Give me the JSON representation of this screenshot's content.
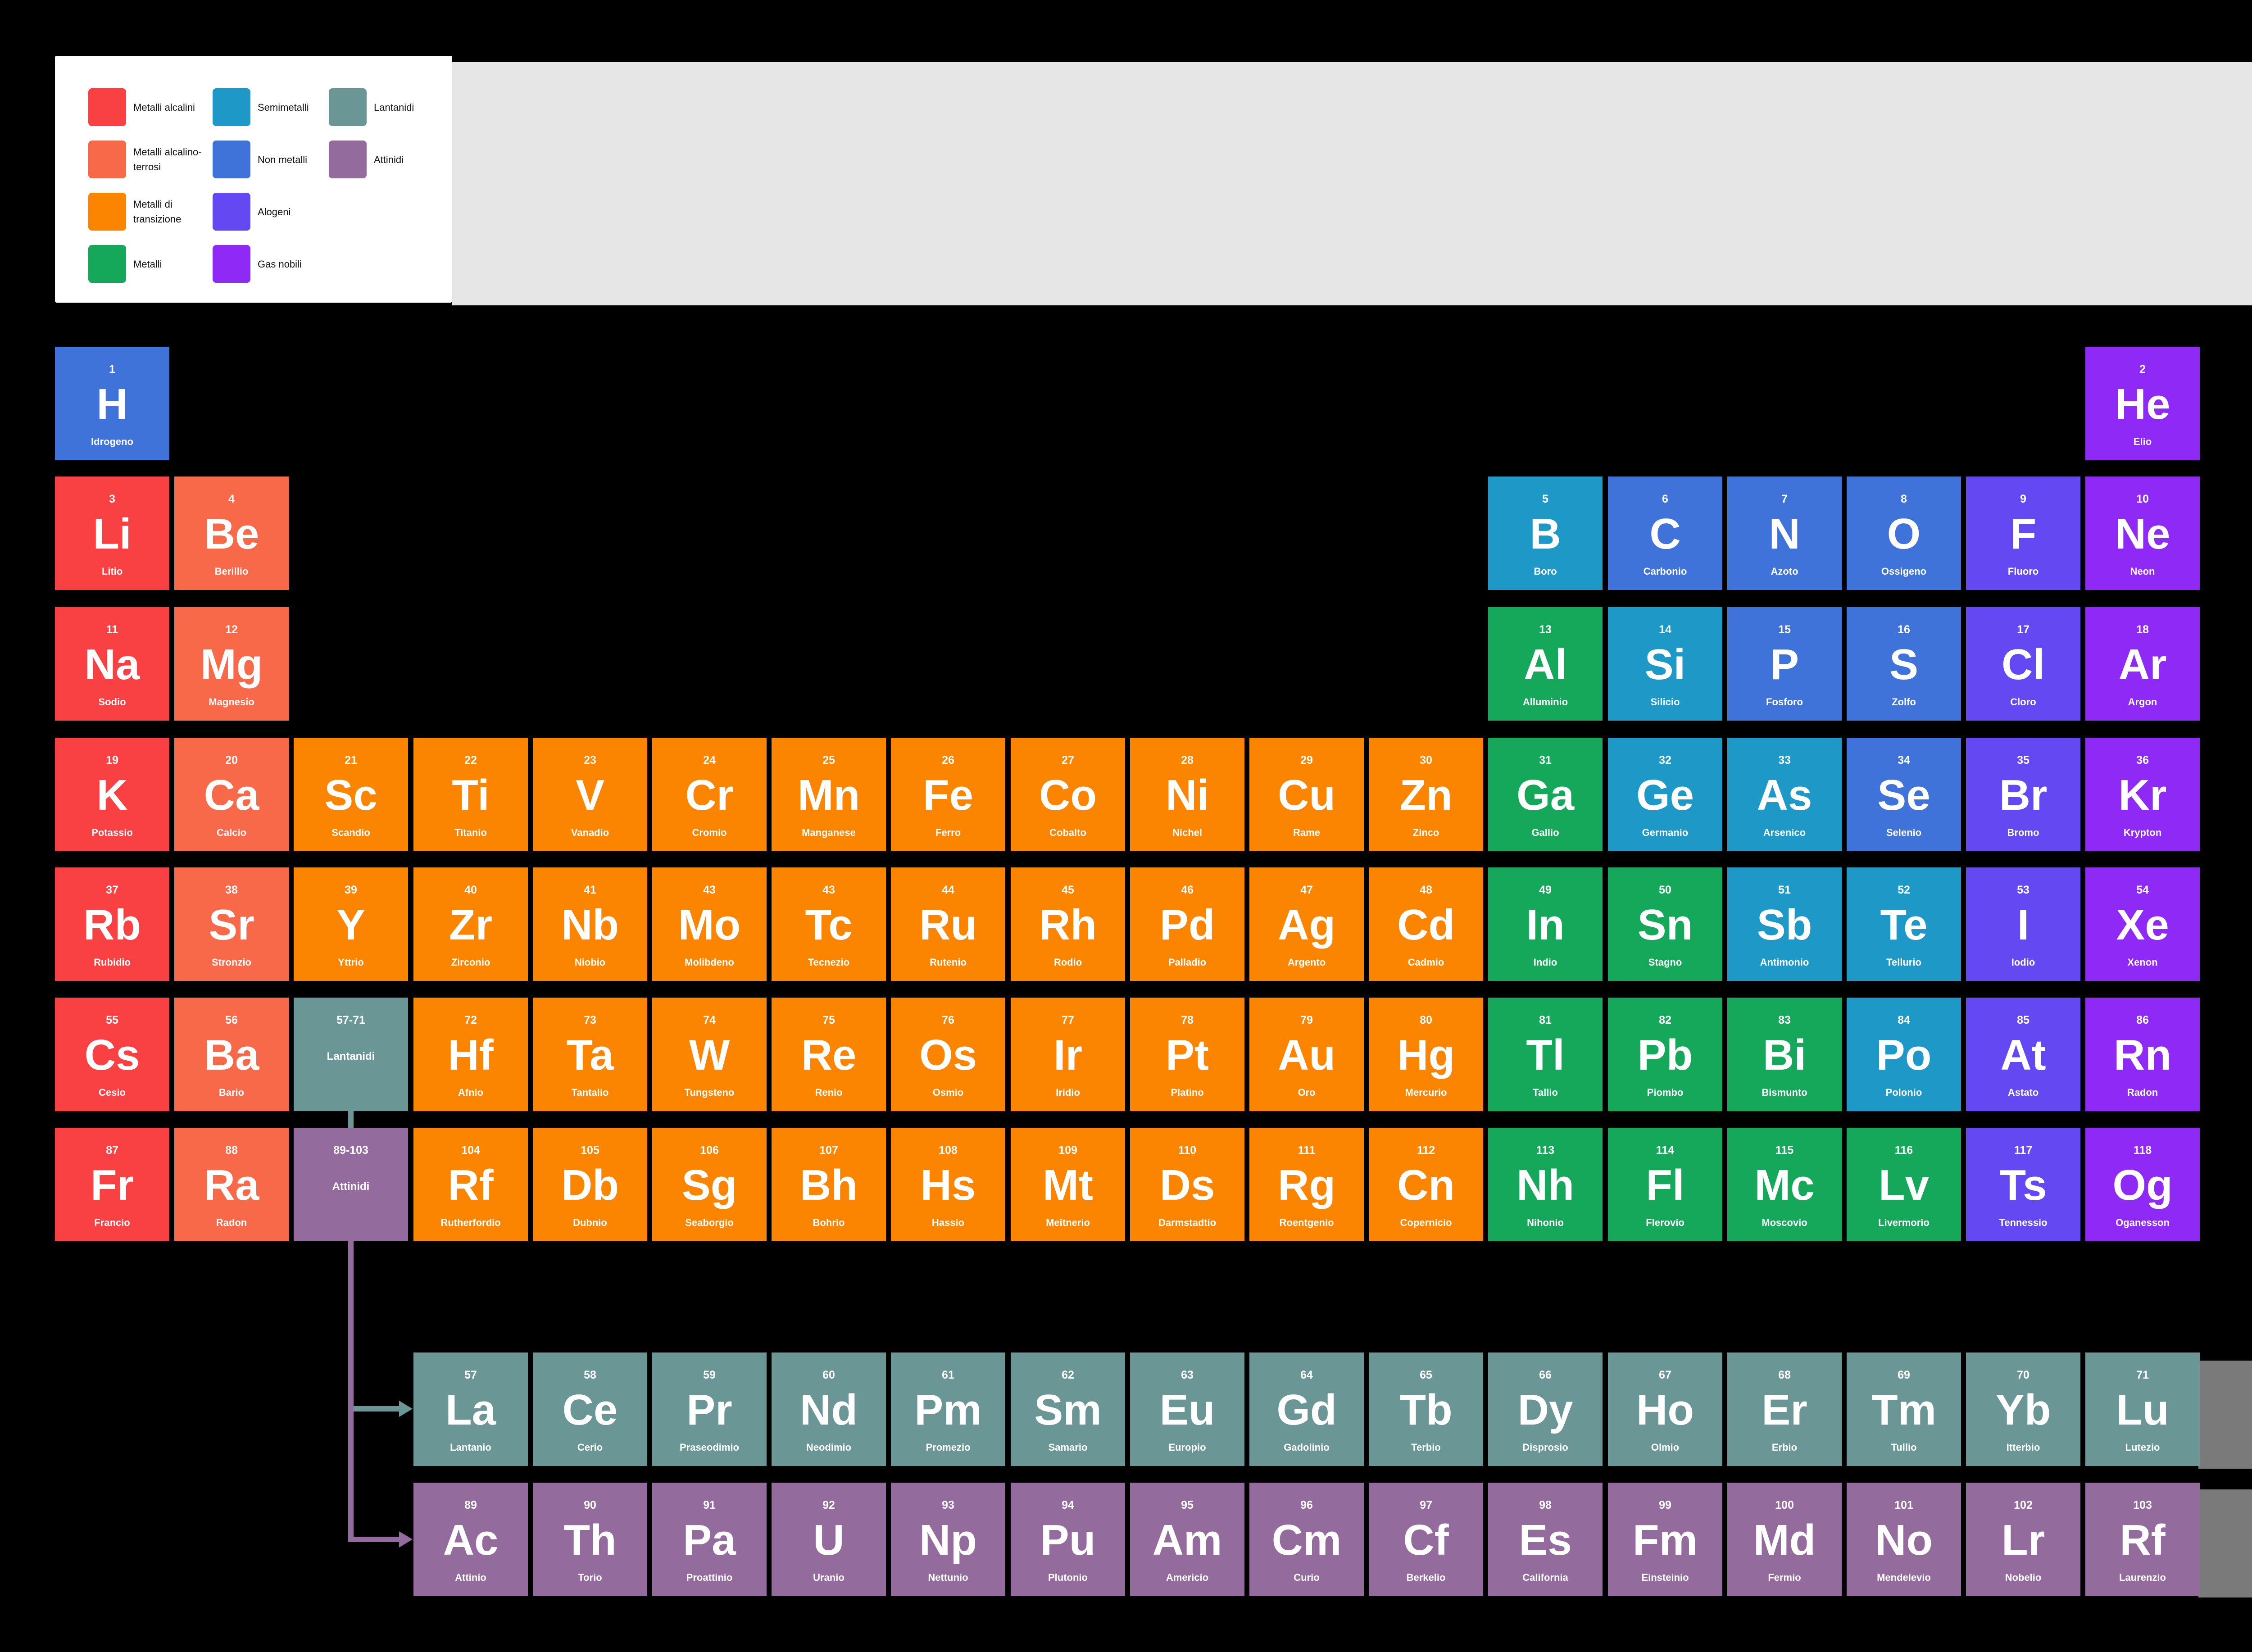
{
  "colors": {
    "alkali": "#f94144",
    "alkaline": "#f8694a",
    "transition": "#fb8500",
    "metal": "#16a85a",
    "metalloid": "#1d98c7",
    "nonmetal": "#3f73d9",
    "halogen": "#6448f2",
    "noble": "#8f2af6",
    "lanthanide": "#6a9695",
    "actinide": "#936b9c"
  },
  "legend": [
    {
      "label": "Metalli alcalini",
      "cat": "alkali"
    },
    {
      "label": "Metalli alcalino-terrosi",
      "cat": "alkaline"
    },
    {
      "label": "Metalli di transizione",
      "cat": "transition"
    },
    {
      "label": "Metalli",
      "cat": "metal"
    },
    {
      "label": "Semimetalli",
      "cat": "metalloid"
    },
    {
      "label": "Non metalli",
      "cat": "nonmetal"
    },
    {
      "label": "Alogeni",
      "cat": "halogen"
    },
    {
      "label": "Gas nobili",
      "cat": "noble"
    },
    {
      "label": "Lantanidi",
      "cat": "lanthanide"
    },
    {
      "label": "Attinidi",
      "cat": "actinide"
    }
  ],
  "elements": [
    {
      "n": "1",
      "s": "H",
      "name": "Idrogeno",
      "c": "nonmetal",
      "r": 0,
      "g": 0
    },
    {
      "n": "2",
      "s": "He",
      "name": "Elio",
      "c": "noble",
      "r": 0,
      "g": 17
    },
    {
      "n": "3",
      "s": "Li",
      "name": "Litio",
      "c": "alkali",
      "r": 1,
      "g": 0
    },
    {
      "n": "4",
      "s": "Be",
      "name": "Berillio",
      "c": "alkaline",
      "r": 1,
      "g": 1
    },
    {
      "n": "5",
      "s": "B",
      "name": "Boro",
      "c": "metalloid",
      "r": 1,
      "g": 12
    },
    {
      "n": "6",
      "s": "C",
      "name": "Carbonio",
      "c": "nonmetal",
      "r": 1,
      "g": 13
    },
    {
      "n": "7",
      "s": "N",
      "name": "Azoto",
      "c": "nonmetal",
      "r": 1,
      "g": 14
    },
    {
      "n": "8",
      "s": "O",
      "name": "Ossigeno",
      "c": "nonmetal",
      "r": 1,
      "g": 15
    },
    {
      "n": "9",
      "s": "F",
      "name": "Fluoro",
      "c": "halogen",
      "r": 1,
      "g": 16
    },
    {
      "n": "10",
      "s": "Ne",
      "name": "Neon",
      "c": "noble",
      "r": 1,
      "g": 17
    },
    {
      "n": "11",
      "s": "Na",
      "name": "Sodio",
      "c": "alkali",
      "r": 2,
      "g": 0
    },
    {
      "n": "12",
      "s": "Mg",
      "name": "Magnesio",
      "c": "alkaline",
      "r": 2,
      "g": 1
    },
    {
      "n": "13",
      "s": "Al",
      "name": "Alluminio",
      "c": "metal",
      "r": 2,
      "g": 12
    },
    {
      "n": "14",
      "s": "Si",
      "name": "Silicio",
      "c": "metalloid",
      "r": 2,
      "g": 13
    },
    {
      "n": "15",
      "s": "P",
      "name": "Fosforo",
      "c": "nonmetal",
      "r": 2,
      "g": 14
    },
    {
      "n": "16",
      "s": "S",
      "name": "Zolfo",
      "c": "nonmetal",
      "r": 2,
      "g": 15
    },
    {
      "n": "17",
      "s": "Cl",
      "name": "Cloro",
      "c": "halogen",
      "r": 2,
      "g": 16
    },
    {
      "n": "18",
      "s": "Ar",
      "name": "Argon",
      "c": "noble",
      "r": 2,
      "g": 17
    },
    {
      "n": "19",
      "s": "K",
      "name": "Potassio",
      "c": "alkali",
      "r": 3,
      "g": 0
    },
    {
      "n": "20",
      "s": "Ca",
      "name": "Calcio",
      "c": "alkaline",
      "r": 3,
      "g": 1
    },
    {
      "n": "21",
      "s": "Sc",
      "name": "Scandio",
      "c": "transition",
      "r": 3,
      "g": 2
    },
    {
      "n": "22",
      "s": "Ti",
      "name": "Titanio",
      "c": "transition",
      "r": 3,
      "g": 3
    },
    {
      "n": "23",
      "s": "V",
      "name": "Vanadio",
      "c": "transition",
      "r": 3,
      "g": 4
    },
    {
      "n": "24",
      "s": "Cr",
      "name": "Cromio",
      "c": "transition",
      "r": 3,
      "g": 5
    },
    {
      "n": "25",
      "s": "Mn",
      "name": "Manganese",
      "c": "transition",
      "r": 3,
      "g": 6
    },
    {
      "n": "26",
      "s": "Fe",
      "name": "Ferro",
      "c": "transition",
      "r": 3,
      "g": 7
    },
    {
      "n": "27",
      "s": "Co",
      "name": "Cobalto",
      "c": "transition",
      "r": 3,
      "g": 8
    },
    {
      "n": "28",
      "s": "Ni",
      "name": "Nichel",
      "c": "transition",
      "r": 3,
      "g": 9
    },
    {
      "n": "29",
      "s": "Cu",
      "name": "Rame",
      "c": "transition",
      "r": 3,
      "g": 10
    },
    {
      "n": "30",
      "s": "Zn",
      "name": "Zinco",
      "c": "transition",
      "r": 3,
      "g": 11
    },
    {
      "n": "31",
      "s": "Ga",
      "name": "Gallio",
      "c": "metal",
      "r": 3,
      "g": 12
    },
    {
      "n": "32",
      "s": "Ge",
      "name": "Germanio",
      "c": "metalloid",
      "r": 3,
      "g": 13
    },
    {
      "n": "33",
      "s": "As",
      "name": "Arsenico",
      "c": "metalloid",
      "r": 3,
      "g": 14
    },
    {
      "n": "34",
      "s": "Se",
      "name": "Selenio",
      "c": "nonmetal",
      "r": 3,
      "g": 15
    },
    {
      "n": "35",
      "s": "Br",
      "name": "Bromo",
      "c": "halogen",
      "r": 3,
      "g": 16
    },
    {
      "n": "36",
      "s": "Kr",
      "name": "Krypton",
      "c": "noble",
      "r": 3,
      "g": 17
    },
    {
      "n": "37",
      "s": "Rb",
      "name": "Rubidio",
      "c": "alkali",
      "r": 4,
      "g": 0
    },
    {
      "n": "38",
      "s": "Sr",
      "name": "Stronzio",
      "c": "alkaline",
      "r": 4,
      "g": 1
    },
    {
      "n": "39",
      "s": "Y",
      "name": "Yttrio",
      "c": "transition",
      "r": 4,
      "g": 2
    },
    {
      "n": "40",
      "s": "Zr",
      "name": "Zirconio",
      "c": "transition",
      "r": 4,
      "g": 3
    },
    {
      "n": "41",
      "s": "Nb",
      "name": "Niobio",
      "c": "transition",
      "r": 4,
      "g": 4
    },
    {
      "n": "43",
      "s": "Mo",
      "name": "Molibdeno",
      "c": "transition",
      "r": 4,
      "g": 5
    },
    {
      "n": "43",
      "s": "Tc",
      "name": "Tecnezio",
      "c": "transition",
      "r": 4,
      "g": 6
    },
    {
      "n": "44",
      "s": "Ru",
      "name": "Rutenio",
      "c": "transition",
      "r": 4,
      "g": 7
    },
    {
      "n": "45",
      "s": "Rh",
      "name": "Rodio",
      "c": "transition",
      "r": 4,
      "g": 8
    },
    {
      "n": "46",
      "s": "Pd",
      "name": "Palladio",
      "c": "transition",
      "r": 4,
      "g": 9
    },
    {
      "n": "47",
      "s": "Ag",
      "name": "Argento",
      "c": "transition",
      "r": 4,
      "g": 10
    },
    {
      "n": "48",
      "s": "Cd",
      "name": "Cadmio",
      "c": "transition",
      "r": 4,
      "g": 11
    },
    {
      "n": "49",
      "s": "In",
      "name": "Indio",
      "c": "metal",
      "r": 4,
      "g": 12
    },
    {
      "n": "50",
      "s": "Sn",
      "name": "Stagno",
      "c": "metal",
      "r": 4,
      "g": 13
    },
    {
      "n": "51",
      "s": "Sb",
      "name": "Antimonio",
      "c": "metalloid",
      "r": 4,
      "g": 14
    },
    {
      "n": "52",
      "s": "Te",
      "name": "Tellurio",
      "c": "metalloid",
      "r": 4,
      "g": 15
    },
    {
      "n": "53",
      "s": "I",
      "name": "Iodio",
      "c": "halogen",
      "r": 4,
      "g": 16
    },
    {
      "n": "54",
      "s": "Xe",
      "name": "Xenon",
      "c": "noble",
      "r": 4,
      "g": 17
    },
    {
      "n": "55",
      "s": "Cs",
      "name": "Cesio",
      "c": "alkali",
      "r": 5,
      "g": 0
    },
    {
      "n": "56",
      "s": "Ba",
      "name": "Bario",
      "c": "alkaline",
      "r": 5,
      "g": 1
    },
    {
      "n": "57-71",
      "s": "",
      "name": "Lantanidi",
      "c": "lanthanide",
      "r": 5,
      "g": 2,
      "series": true
    },
    {
      "n": "72",
      "s": "Hf",
      "name": "Afnio",
      "c": "transition",
      "r": 5,
      "g": 3
    },
    {
      "n": "73",
      "s": "Ta",
      "name": "Tantalio",
      "c": "transition",
      "r": 5,
      "g": 4
    },
    {
      "n": "74",
      "s": "W",
      "name": "Tungsteno",
      "c": "transition",
      "r": 5,
      "g": 5
    },
    {
      "n": "75",
      "s": "Re",
      "name": "Renio",
      "c": "transition",
      "r": 5,
      "g": 6
    },
    {
      "n": "76",
      "s": "Os",
      "name": "Osmio",
      "c": "transition",
      "r": 5,
      "g": 7
    },
    {
      "n": "77",
      "s": "Ir",
      "name": "Iridio",
      "c": "transition",
      "r": 5,
      "g": 8
    },
    {
      "n": "78",
      "s": "Pt",
      "name": "Platino",
      "c": "transition",
      "r": 5,
      "g": 9
    },
    {
      "n": "79",
      "s": "Au",
      "name": "Oro",
      "c": "transition",
      "r": 5,
      "g": 10
    },
    {
      "n": "80",
      "s": "Hg",
      "name": "Mercurio",
      "c": "transition",
      "r": 5,
      "g": 11
    },
    {
      "n": "81",
      "s": "Tl",
      "name": "Tallio",
      "c": "metal",
      "r": 5,
      "g": 12
    },
    {
      "n": "82",
      "s": "Pb",
      "name": "Piombo",
      "c": "metal",
      "r": 5,
      "g": 13
    },
    {
      "n": "83",
      "s": "Bi",
      "name": "Bismunto",
      "c": "metal",
      "r": 5,
      "g": 14
    },
    {
      "n": "84",
      "s": "Po",
      "name": "Polonio",
      "c": "metalloid",
      "r": 5,
      "g": 15
    },
    {
      "n": "85",
      "s": "At",
      "name": "Astato",
      "c": "halogen",
      "r": 5,
      "g": 16
    },
    {
      "n": "86",
      "s": "Rn",
      "name": "Radon",
      "c": "noble",
      "r": 5,
      "g": 17
    },
    {
      "n": "87",
      "s": "Fr",
      "name": "Francio",
      "c": "alkali",
      "r": 6,
      "g": 0
    },
    {
      "n": "88",
      "s": "Ra",
      "name": "Radon",
      "c": "alkaline",
      "r": 6,
      "g": 1
    },
    {
      "n": "89-103",
      "s": "",
      "name": "Attinidi",
      "c": "actinide",
      "r": 6,
      "g": 2,
      "series": true
    },
    {
      "n": "104",
      "s": "Rf",
      "name": "Rutherfordio",
      "c": "transition",
      "r": 6,
      "g": 3
    },
    {
      "n": "105",
      "s": "Db",
      "name": "Dubnio",
      "c": "transition",
      "r": 6,
      "g": 4
    },
    {
      "n": "106",
      "s": "Sg",
      "name": "Seaborgio",
      "c": "transition",
      "r": 6,
      "g": 5
    },
    {
      "n": "107",
      "s": "Bh",
      "name": "Bohrio",
      "c": "transition",
      "r": 6,
      "g": 6
    },
    {
      "n": "108",
      "s": "Hs",
      "name": "Hassio",
      "c": "transition",
      "r": 6,
      "g": 7
    },
    {
      "n": "109",
      "s": "Mt",
      "name": "Meitnerio",
      "c": "transition",
      "r": 6,
      "g": 8
    },
    {
      "n": "110",
      "s": "Ds",
      "name": "Darmstadtio",
      "c": "transition",
      "r": 6,
      "g": 9
    },
    {
      "n": "111",
      "s": "Rg",
      "name": "Roentgenio",
      "c": "transition",
      "r": 6,
      "g": 10
    },
    {
      "n": "112",
      "s": "Cn",
      "name": "Copernicio",
      "c": "transition",
      "r": 6,
      "g": 11
    },
    {
      "n": "113",
      "s": "Nh",
      "name": "Nihonio",
      "c": "metal",
      "r": 6,
      "g": 12
    },
    {
      "n": "114",
      "s": "Fl",
      "name": "Flerovio",
      "c": "metal",
      "r": 6,
      "g": 13
    },
    {
      "n": "115",
      "s": "Mc",
      "name": "Moscovio",
      "c": "metal",
      "r": 6,
      "g": 14
    },
    {
      "n": "116",
      "s": "Lv",
      "name": "Livermorio",
      "c": "metal",
      "r": 6,
      "g": 15
    },
    {
      "n": "117",
      "s": "Ts",
      "name": "Tennessio",
      "c": "halogen",
      "r": 6,
      "g": 16
    },
    {
      "n": "118",
      "s": "Og",
      "name": "Oganesson",
      "c": "noble",
      "r": 6,
      "g": 17
    },
    {
      "n": "57",
      "s": "La",
      "name": "Lantanio",
      "c": "lanthanide",
      "r": 7,
      "g": 3
    },
    {
      "n": "58",
      "s": "Ce",
      "name": "Cerio",
      "c": "lanthanide",
      "r": 7,
      "g": 4
    },
    {
      "n": "59",
      "s": "Pr",
      "name": "Praseodimio",
      "c": "lanthanide",
      "r": 7,
      "g": 5
    },
    {
      "n": "60",
      "s": "Nd",
      "name": "Neodimio",
      "c": "lanthanide",
      "r": 7,
      "g": 6
    },
    {
      "n": "61",
      "s": "Pm",
      "name": "Promezio",
      "c": "lanthanide",
      "r": 7,
      "g": 7
    },
    {
      "n": "62",
      "s": "Sm",
      "name": "Samario",
      "c": "lanthanide",
      "r": 7,
      "g": 8
    },
    {
      "n": "63",
      "s": "Eu",
      "name": "Europio",
      "c": "lanthanide",
      "r": 7,
      "g": 9
    },
    {
      "n": "64",
      "s": "Gd",
      "name": "Gadolinio",
      "c": "lanthanide",
      "r": 7,
      "g": 10
    },
    {
      "n": "65",
      "s": "Tb",
      "name": "Terbio",
      "c": "lanthanide",
      "r": 7,
      "g": 11
    },
    {
      "n": "66",
      "s": "Dy",
      "name": "Disprosio",
      "c": "lanthanide",
      "r": 7,
      "g": 12
    },
    {
      "n": "67",
      "s": "Ho",
      "name": "Olmio",
      "c": "lanthanide",
      "r": 7,
      "g": 13
    },
    {
      "n": "68",
      "s": "Er",
      "name": "Erbio",
      "c": "lanthanide",
      "r": 7,
      "g": 14
    },
    {
      "n": "69",
      "s": "Tm",
      "name": "Tullio",
      "c": "lanthanide",
      "r": 7,
      "g": 15
    },
    {
      "n": "70",
      "s": "Yb",
      "name": "Itterbio",
      "c": "lanthanide",
      "r": 7,
      "g": 16
    },
    {
      "n": "71",
      "s": "Lu",
      "name": "Lutezio",
      "c": "lanthanide",
      "r": 7,
      "g": 17
    },
    {
      "n": "89",
      "s": "Ac",
      "name": "Attinio",
      "c": "actinide",
      "r": 8,
      "g": 3
    },
    {
      "n": "90",
      "s": "Th",
      "name": "Torio",
      "c": "actinide",
      "r": 8,
      "g": 4
    },
    {
      "n": "91",
      "s": "Pa",
      "name": "Proattinio",
      "c": "actinide",
      "r": 8,
      "g": 5
    },
    {
      "n": "92",
      "s": "U",
      "name": "Uranio",
      "c": "actinide",
      "r": 8,
      "g": 6
    },
    {
      "n": "93",
      "s": "Np",
      "name": "Nettunio",
      "c": "actinide",
      "r": 8,
      "g": 7
    },
    {
      "n": "94",
      "s": "Pu",
      "name": "Plutonio",
      "c": "actinide",
      "r": 8,
      "g": 8
    },
    {
      "n": "95",
      "s": "Am",
      "name": "Americio",
      "c": "actinide",
      "r": 8,
      "g": 9
    },
    {
      "n": "96",
      "s": "Cm",
      "name": "Curio",
      "c": "actinide",
      "r": 8,
      "g": 10
    },
    {
      "n": "97",
      "s": "Cf",
      "name": "Berkelio",
      "c": "actinide",
      "r": 8,
      "g": 11
    },
    {
      "n": "98",
      "s": "Es",
      "name": "California",
      "c": "actinide",
      "r": 8,
      "g": 12
    },
    {
      "n": "99",
      "s": "Fm",
      "name": "Einsteinio",
      "c": "actinide",
      "r": 8,
      "g": 13
    },
    {
      "n": "100",
      "s": "Md",
      "name": "Fermio",
      "c": "actinide",
      "r": 8,
      "g": 14
    },
    {
      "n": "101",
      "s": "No",
      "name": "Mendelevio",
      "c": "actinide",
      "r": 8,
      "g": 15
    },
    {
      "n": "102",
      "s": "Lr",
      "name": "Nobelio",
      "c": "actinide",
      "r": 8,
      "g": 16
    },
    {
      "n": "103",
      "s": "Rf",
      "name": "Laurenzio",
      "c": "actinide",
      "r": 8,
      "g": 17
    }
  ]
}
